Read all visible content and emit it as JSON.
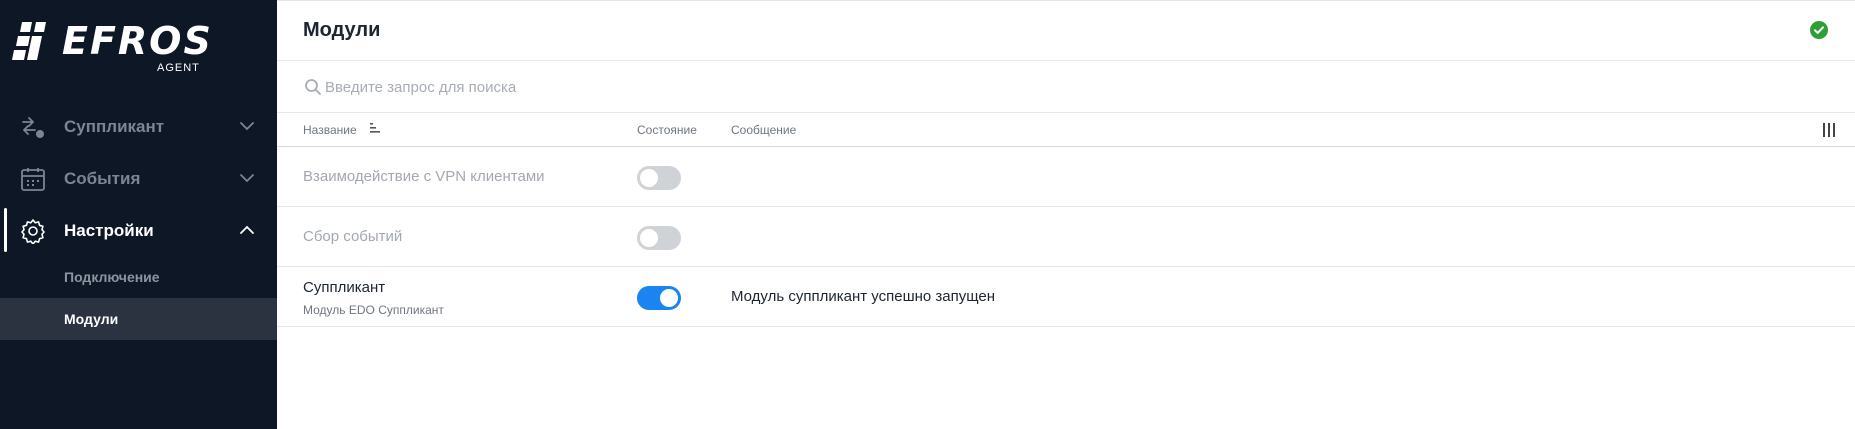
{
  "sidebar": {
    "logo_text": "EFROS",
    "logo_subtext": "AGENT",
    "items": [
      {
        "label": "Суппликант",
        "icon": "supplicant-icon",
        "expanded": false
      },
      {
        "label": "События",
        "icon": "calendar-icon",
        "expanded": false
      },
      {
        "label": "Настройки",
        "icon": "gear-icon",
        "expanded": true
      }
    ],
    "subitems": [
      {
        "label": "Подключение",
        "selected": false
      },
      {
        "label": "Модули",
        "selected": true
      }
    ]
  },
  "header": {
    "title": "Модули",
    "status_icon": "check-circle-icon",
    "status_color": "#2e9e35"
  },
  "search": {
    "placeholder": "Введите запрос для поиска",
    "value": ""
  },
  "table": {
    "columns": [
      "Название",
      "Состояние",
      "Сообщение"
    ],
    "rows": [
      {
        "name": "Взаимодействие с VPN клиентами",
        "description": "",
        "enabled": false,
        "message": ""
      },
      {
        "name": "Сбор событий",
        "description": "",
        "enabled": false,
        "message": ""
      },
      {
        "name": "Суппликант",
        "description": "Модуль EDO Суппликант",
        "enabled": true,
        "message": "Модуль суппликант успешно запущен"
      }
    ]
  },
  "colors": {
    "sidebar_bg": "#0d1726",
    "selected_bg": "#2b3340",
    "toggle_on": "#1a84f1",
    "toggle_off": "#cfd2d6"
  }
}
